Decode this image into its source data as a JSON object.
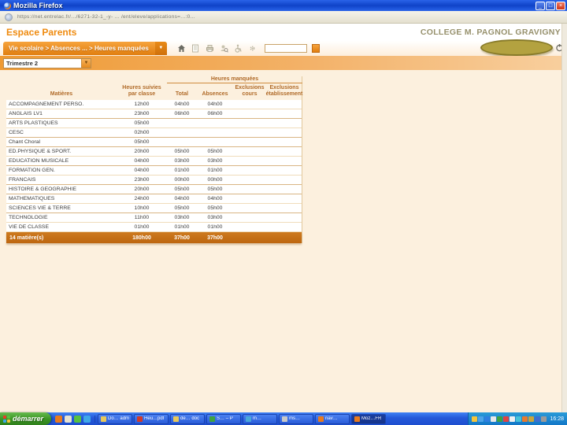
{
  "window": {
    "title": "Mozilla Firefox",
    "url": "https://net.entrelac.fr/.../6271-32-1_-y- ... /ent/eleve/applications=...:0..."
  },
  "header": {
    "app_title": "Espace Parents",
    "school_name": "COLLEGE M. PAGNOL GRAVIGNY"
  },
  "nav": {
    "breadcrumb": "Vie scolaire > Absences ... > Heures manquées",
    "search_value": "",
    "icons": [
      "home-icon",
      "document-icon",
      "printer-icon",
      "user-search-icon",
      "accessibility-icon",
      "settings-icon"
    ]
  },
  "filter": {
    "period": "Trimestre 2"
  },
  "table": {
    "headers": {
      "matieres": "Matières",
      "heures_suivies": "Heures suivies par classe",
      "heures_manquees": "Heures manquées",
      "total": "Total",
      "absences": "Absences",
      "exclusions_cours": "Exclusions cours",
      "exclusions_etablissement": "Exclusions établissement"
    },
    "rows": [
      {
        "matiere": "ACCOMPAGNEMENT PERSO.",
        "suivies": "12h00",
        "total": "04h00",
        "absences": "04h00",
        "excl_cours": "",
        "excl_etab": "",
        "group_end": false
      },
      {
        "matiere": "ANGLAIS LV1",
        "suivies": "23h00",
        "total": "06h00",
        "absences": "06h00",
        "excl_cours": "",
        "excl_etab": "",
        "group_end": true
      },
      {
        "matiere": "ARTS PLASTIQUES",
        "suivies": "05h00",
        "total": "",
        "absences": "",
        "excl_cours": "",
        "excl_etab": "",
        "group_end": false
      },
      {
        "matiere": "CESC",
        "suivies": "02h00",
        "total": "",
        "absences": "",
        "excl_cours": "",
        "excl_etab": "",
        "group_end": true
      },
      {
        "matiere": "Chant Choral",
        "suivies": "05h00",
        "total": "",
        "absences": "",
        "excl_cours": "",
        "excl_etab": "",
        "group_end": true
      },
      {
        "matiere": "ED.PHYSIQUE & SPORT.",
        "suivies": "20h00",
        "total": "05h00",
        "absences": "05h00",
        "excl_cours": "",
        "excl_etab": "",
        "group_end": false
      },
      {
        "matiere": "EDUCATION MUSICALE",
        "suivies": "04h00",
        "total": "03h00",
        "absences": "03h00",
        "excl_cours": "",
        "excl_etab": "",
        "group_end": true
      },
      {
        "matiere": "FORMATION GEN.",
        "suivies": "04h00",
        "total": "01h00",
        "absences": "01h00",
        "excl_cours": "",
        "excl_etab": "",
        "group_end": false
      },
      {
        "matiere": "FRANCAIS",
        "suivies": "23h00",
        "total": "00h00",
        "absences": "00h00",
        "excl_cours": "",
        "excl_etab": "",
        "group_end": true
      },
      {
        "matiere": "HISTOIRE & GEOGRAPHIE",
        "suivies": "20h00",
        "total": "05h00",
        "absences": "05h00",
        "excl_cours": "",
        "excl_etab": "",
        "group_end": true
      },
      {
        "matiere": "MATHEMATIQUES",
        "suivies": "24h00",
        "total": "04h00",
        "absences": "04h00",
        "excl_cours": "",
        "excl_etab": "",
        "group_end": false
      },
      {
        "matiere": "SCIENCES VIE & TERRE",
        "suivies": "10h00",
        "total": "05h00",
        "absences": "05h00",
        "excl_cours": "",
        "excl_etab": "",
        "group_end": true
      },
      {
        "matiere": "TECHNOLOGIE",
        "suivies": "11h00",
        "total": "03h00",
        "absences": "03h00",
        "excl_cours": "",
        "excl_etab": "",
        "group_end": false
      },
      {
        "matiere": "VIE DE CLASSE",
        "suivies": "01h00",
        "total": "01h00",
        "absences": "01h00",
        "excl_cours": "",
        "excl_etab": "",
        "group_end": false
      }
    ],
    "total_row": {
      "label": "14 matière(s)",
      "suivies": "180h00",
      "total": "37h00",
      "absences": "37h00",
      "excl_cours": "",
      "excl_etab": ""
    }
  },
  "appearance": {
    "accent_orange": "#ef8b10",
    "total_row_bg": "#bd660f",
    "taskbar_blue": "#2458d8",
    "start_green": "#3a9423",
    "content_bg": "#fcf0de"
  },
  "taskbar": {
    "start_label": "démarrer",
    "quick_launch": [
      "browser-icon",
      "mail-icon",
      "messenger-icon",
      "explorer-icon"
    ],
    "quick_colors": [
      "#e87a1e",
      "#e8e2d0",
      "#58c040",
      "#3fa8e8"
    ],
    "tasks": [
      {
        "label": "Do… adm",
        "icon": "folder-icon",
        "color": "#e8c85a",
        "active": false
      },
      {
        "label": "Heu…pdf",
        "icon": "pdf-icon",
        "color": "#d03a2a",
        "active": false
      },
      {
        "label": "de… doc",
        "icon": "folder-icon",
        "color": "#e8c85a",
        "active": false
      },
      {
        "label": "S… – P",
        "icon": "app-icon",
        "color": "#3fa33f",
        "active": false
      },
      {
        "label": "m…",
        "icon": "app-icon",
        "color": "#4aa8d8",
        "active": false
      },
      {
        "label": "ms…",
        "icon": "app-icon",
        "color": "#c8c8c8",
        "active": false
      },
      {
        "label": "nav…",
        "icon": "firefox-icon",
        "color": "#e87a1e",
        "active": false
      },
      {
        "label": "Moz…FR",
        "icon": "firefox-icon",
        "color": "#e87a1e",
        "active": true
      }
    ],
    "tray_colors": [
      "#f5c53c",
      "#4da3e8",
      "#2f7fe0",
      "#e8e8e8",
      "#3fa33f",
      "#e04343",
      "#f0f0f0",
      "#47c2d8",
      "#e87a2e",
      "#caa53c",
      "#3f6fd0",
      "#9a9a9a"
    ],
    "clock": "16:28"
  }
}
